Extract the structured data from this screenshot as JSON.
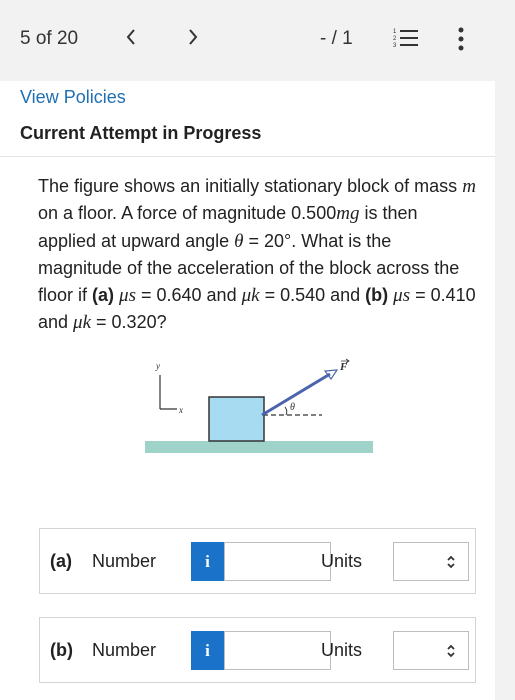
{
  "topbar": {
    "counter": "5 of 20",
    "prev_icon": "chevron-left-icon",
    "next_icon": "chevron-right-icon",
    "score": "- / 1",
    "list_icon": "numbered-list-icon",
    "more_icon": "more-vertical-icon"
  },
  "header": {
    "view_policies": "View Policies",
    "attempt_status": "Current Attempt in Progress"
  },
  "question": {
    "t1": "The figure shows an initially stationary block of mass ",
    "m": "m",
    "t2": " on a floor. A force of magnitude 0.500",
    "mg": "mg",
    "t3": " is then applied at upward angle ",
    "theta": "θ",
    "t4": " = 20°. What is the magnitude of the acceleration of the block across the floor if ",
    "a_label": "(a)",
    "mu_s_a": "μs",
    "t5": " = 0.640 and ",
    "mu_k_a": "μk",
    "t6": " = 0.540 and ",
    "b_label": "(b)",
    "mu_s_b": "μs",
    "t7": " = 0.410 and ",
    "mu_k_b": "μk",
    "t8": " = 0.320?"
  },
  "figure": {
    "y_axis": "y",
    "x_axis": "x",
    "force_label": "F",
    "angle_label": "θ",
    "floor_color": "#9fd2c9",
    "block_color": "#a7dbf1",
    "force_color": "#4b64ad"
  },
  "answers": [
    {
      "part": "(a)",
      "number_label": "Number",
      "info": "i",
      "value": "",
      "units_label": "Units",
      "units_value": ""
    },
    {
      "part": "(b)",
      "number_label": "Number",
      "info": "i",
      "value": "",
      "units_label": "Units",
      "units_value": ""
    }
  ],
  "colors": {
    "link": "#1f6fb2",
    "info_button": "#1a73c9",
    "background": "#f2f2f2"
  }
}
